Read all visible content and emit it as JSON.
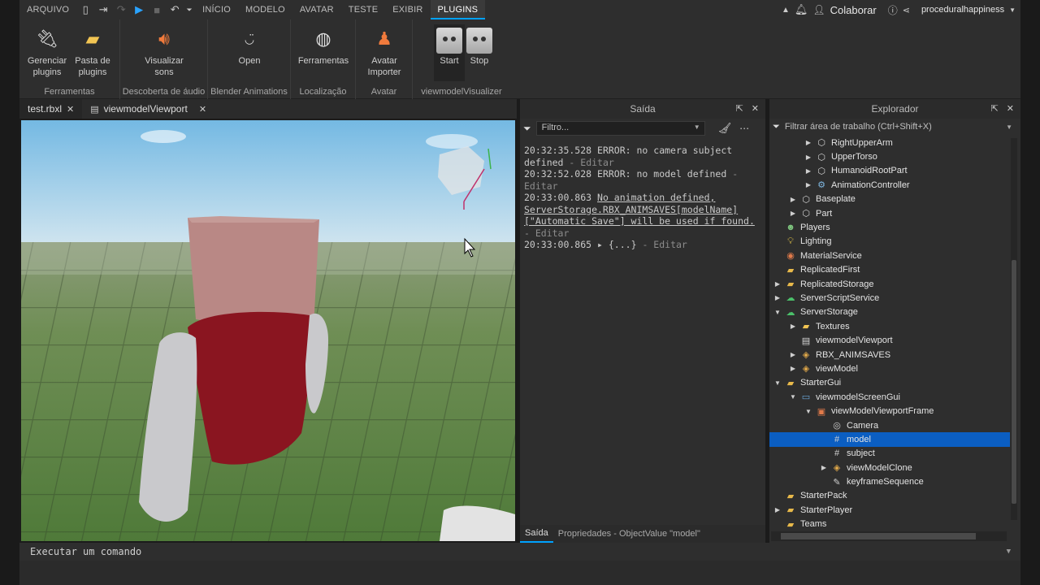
{
  "menubar": {
    "file_label": "ARQUIVO",
    "tabs": [
      "INÍCIO",
      "MODELO",
      "AVATAR",
      "TESTE",
      "EXIBIR",
      "PLUGINS"
    ],
    "collaborate_label": "Colaborar",
    "username": "proceduralhappiness"
  },
  "ribbon": {
    "groups": [
      {
        "label": "Ferramentas",
        "buttons": [
          "Gerenciar plugins",
          "Pasta de plugins"
        ]
      },
      {
        "label": "Descoberta de áudio",
        "buttons": [
          "Visualizar sons"
        ]
      },
      {
        "label": "Blender Animations",
        "buttons": [
          "Open"
        ]
      },
      {
        "label": "Localização",
        "buttons": [
          "Ferramentas"
        ]
      },
      {
        "label": "Avatar",
        "buttons": [
          "Avatar Importer"
        ]
      },
      {
        "label": "viewmodelVisualizer",
        "buttons": [
          "Start",
          "Stop"
        ]
      }
    ],
    "b_gerenciar_1": "Gerenciar",
    "b_gerenciar_2": "plugins",
    "b_pasta_1": "Pasta de",
    "b_pasta_2": "plugins",
    "b_visualizar_1": "Visualizar",
    "b_visualizar_2": "sons",
    "b_avatar_1": "Avatar",
    "b_avatar_2": "Importer"
  },
  "doc_tabs": [
    {
      "label": "test.rbxl",
      "selected": true
    },
    {
      "label": "viewmodelViewport",
      "selected": false
    }
  ],
  "output": {
    "title": "Saída",
    "filter_placeholder": "Filtro...",
    "entries": [
      {
        "time": "20:32:35.528",
        "text": "ERROR: no camera subject defined",
        "action": "Editar"
      },
      {
        "time": "20:32:52.028",
        "text": "ERROR: no model defined",
        "action": "Editar"
      },
      {
        "time": "20:33:00.863",
        "text": "No animation defined, ServerStorage.RBX_ANIMSAVES[modelName][\"Automatic Save\"] will be used if found.",
        "action": "Editar"
      },
      {
        "time": "20:33:00.865",
        "text": "▸ {...}",
        "action": "Editar"
      }
    ],
    "bottom_tab_output": "Saída",
    "bottom_tab_props": "Propriedades - ObjectValue \"model\""
  },
  "explorer": {
    "title": "Explorador",
    "filter_placeholder": "Filtrar área de trabalho (Ctrl+Shift+X)",
    "rows": [
      {
        "label": "RightUpperArm",
        "depth": 2,
        "arrow": "▶",
        "icon": "part-icon"
      },
      {
        "label": "UpperTorso",
        "depth": 2,
        "arrow": "▶",
        "icon": "part-icon"
      },
      {
        "label": "HumanoidRootPart",
        "depth": 2,
        "arrow": "▶",
        "icon": "part-icon"
      },
      {
        "label": "AnimationController",
        "depth": 2,
        "arrow": "▶",
        "icon": "animation-controller-icon"
      },
      {
        "label": "Baseplate",
        "depth": 1,
        "arrow": "▶",
        "icon": "part-icon"
      },
      {
        "label": "Part",
        "depth": 1,
        "arrow": "▶",
        "icon": "part-icon"
      },
      {
        "label": "Players",
        "depth": 0,
        "arrow": "",
        "icon": "players-icon"
      },
      {
        "label": "Lighting",
        "depth": 0,
        "arrow": "",
        "icon": "lighting-icon"
      },
      {
        "label": "MaterialService",
        "depth": 0,
        "arrow": "",
        "icon": "material-service-icon"
      },
      {
        "label": "ReplicatedFirst",
        "depth": 0,
        "arrow": "",
        "icon": "replicated-first-icon"
      },
      {
        "label": "ReplicatedStorage",
        "depth": 0,
        "arrow": "▶",
        "icon": "replicated-storage-icon"
      },
      {
        "label": "ServerScriptService",
        "depth": 0,
        "arrow": "▶",
        "icon": "server-script-service-icon"
      },
      {
        "label": "ServerStorage",
        "depth": 0,
        "arrow": "▼",
        "icon": "server-storage-icon"
      },
      {
        "label": "Textures",
        "depth": 1,
        "arrow": "▶",
        "icon": "folder-icon"
      },
      {
        "label": "viewmodelViewport",
        "depth": 1,
        "arrow": "",
        "icon": "script-icon"
      },
      {
        "label": "RBX_ANIMSAVES",
        "depth": 1,
        "arrow": "▶",
        "icon": "model-icon"
      },
      {
        "label": "viewModel",
        "depth": 1,
        "arrow": "▶",
        "icon": "model-icon"
      },
      {
        "label": "StarterGui",
        "depth": 0,
        "arrow": "▼",
        "icon": "starter-gui-icon"
      },
      {
        "label": "viewmodelScreenGui",
        "depth": 1,
        "arrow": "▼",
        "icon": "screen-gui-icon"
      },
      {
        "label": "viewModelViewportFrame",
        "depth": 2,
        "arrow": "▼",
        "icon": "viewport-frame-icon"
      },
      {
        "label": "Camera",
        "depth": 3,
        "arrow": "",
        "icon": "camera-icon"
      },
      {
        "label": "model",
        "depth": 3,
        "arrow": "",
        "icon": "object-value-icon",
        "selected": true
      },
      {
        "label": "subject",
        "depth": 3,
        "arrow": "",
        "icon": "object-value-icon"
      },
      {
        "label": "viewModelClone",
        "depth": 3,
        "arrow": "▶",
        "icon": "model-icon"
      },
      {
        "label": "keyframeSequence",
        "depth": 3,
        "arrow": "",
        "icon": "keyframe-sequence-icon"
      },
      {
        "label": "StarterPack",
        "depth": 0,
        "arrow": "",
        "icon": "starter-pack-icon"
      },
      {
        "label": "StarterPlayer",
        "depth": 0,
        "arrow": "▶",
        "icon": "starter-player-icon"
      },
      {
        "label": "Teams",
        "depth": 0,
        "arrow": "",
        "icon": "teams-icon"
      }
    ]
  },
  "command_bar": {
    "placeholder": "Executar um comando"
  },
  "colors": {
    "accent": "#00a2ff",
    "selection": "#0b5ec2",
    "panel": "#2e2e2e"
  }
}
